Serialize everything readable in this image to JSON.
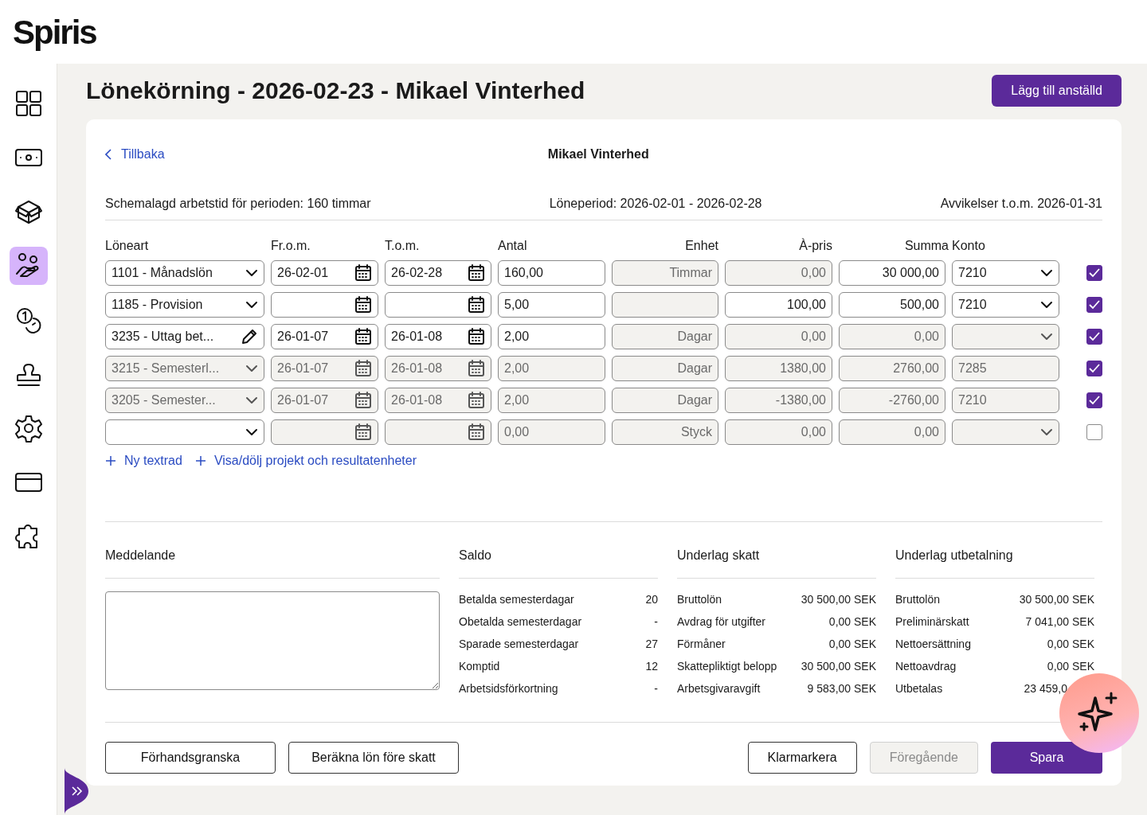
{
  "logo": "Spiris",
  "sidebar": {
    "items": [
      {
        "selected": false
      },
      {
        "selected": false
      },
      {
        "selected": false
      },
      {
        "selected": true
      },
      {
        "selected": false
      },
      {
        "selected": false
      },
      {
        "selected": false
      },
      {
        "selected": false
      },
      {
        "selected": false
      }
    ]
  },
  "page_title": "Lönekörning - 2026-02-23 - Mikael Vinterhed",
  "add_employee_button": "Lägg till anställd",
  "back_link": "Tillbaka",
  "employee_name": "Mikael Vinterhed",
  "info": [
    "Schemalagd arbetstid för perioden: 160 timmar",
    "Löneperiod: 2026-02-01 - 2026-02-28",
    "Avvikelser t.o.m. 2026-01-31"
  ],
  "table": {
    "columns": [
      "Löneart",
      "Fr.o.m.",
      "T.o.m.",
      "Antal",
      "Enhet",
      "À-pris",
      "Summa",
      "Konto"
    ],
    "rows": [
      {
        "art": {
          "value": "1101 - Månadslön",
          "kind": "select",
          "disabled": false
        },
        "from": {
          "value": "26-02-01",
          "disabled": false
        },
        "to": {
          "value": "26-02-28",
          "disabled": false
        },
        "antal": {
          "value": "160,00",
          "disabled": false
        },
        "enhet": {
          "value": "Timmar",
          "disabled": true
        },
        "apris": {
          "value": "0,00",
          "disabled": true
        },
        "summa": {
          "value": "30 000,00",
          "disabled": false
        },
        "konto": {
          "value": "7210",
          "kind": "select",
          "disabled": false
        },
        "checked": true
      },
      {
        "art": {
          "value": "1185 - Provision",
          "kind": "select",
          "disabled": false
        },
        "from": {
          "disabled": false
        },
        "to": {
          "disabled": false
        },
        "antal": {
          "value": "5,00",
          "disabled": false
        },
        "enhet": {
          "disabled": true
        },
        "apris": {
          "value": "100,00",
          "disabled": false
        },
        "summa": {
          "value": "500,00",
          "disabled": false
        },
        "konto": {
          "value": "7210",
          "kind": "select",
          "disabled": false
        },
        "checked": true
      },
      {
        "art": {
          "value": "3235 - Uttag bet...",
          "kind": "edit",
          "disabled": false
        },
        "from": {
          "value": "26-01-07",
          "disabled": false
        },
        "to": {
          "value": "26-01-08",
          "disabled": false
        },
        "antal": {
          "value": "2,00",
          "disabled": false
        },
        "enhet": {
          "value": "Dagar",
          "disabled": true
        },
        "apris": {
          "value": "0,00",
          "disabled": true
        },
        "summa": {
          "value": "0,00",
          "disabled": true
        },
        "konto": {
          "kind": "select",
          "disabled": true
        },
        "checked": true
      },
      {
        "art": {
          "value": "3215 - Semesterl...",
          "kind": "select",
          "disabled": true
        },
        "from": {
          "value": "26-01-07",
          "disabled": true
        },
        "to": {
          "value": "26-01-08",
          "disabled": true
        },
        "antal": {
          "value": "2,00",
          "disabled": true
        },
        "enhet": {
          "value": "Dagar",
          "disabled": true
        },
        "apris": {
          "value": "1380,00",
          "disabled": true
        },
        "summa": {
          "value": "2760,00",
          "disabled": true
        },
        "konto": {
          "value": "7285",
          "kind": "text",
          "disabled": true
        },
        "checked": true
      },
      {
        "art": {
          "value": "3205 - Semester...",
          "kind": "select",
          "disabled": true
        },
        "from": {
          "value": "26-01-07",
          "disabled": true
        },
        "to": {
          "value": "26-01-08",
          "disabled": true
        },
        "antal": {
          "value": "2,00",
          "disabled": true
        },
        "enhet": {
          "value": "Dagar",
          "disabled": true
        },
        "apris": {
          "value": "-1380,00",
          "disabled": true
        },
        "summa": {
          "value": "-2760,00",
          "disabled": true
        },
        "konto": {
          "value": "7210",
          "kind": "text",
          "disabled": true
        },
        "checked": true
      },
      {
        "art": {
          "kind": "select",
          "disabled": false
        },
        "from": {
          "disabled": true
        },
        "to": {
          "disabled": true
        },
        "antal": {
          "value": "0,00",
          "disabled": true
        },
        "enhet": {
          "value": "Styck",
          "disabled": true
        },
        "apris": {
          "value": "0,00",
          "disabled": true
        },
        "summa": {
          "value": "0,00",
          "disabled": true
        },
        "konto": {
          "kind": "select",
          "disabled": true
        },
        "checked": false
      }
    ]
  },
  "links": [
    "Ny textrad",
    "Visa/dölj projekt och resultatenheter"
  ],
  "message": {
    "title": "Meddelande"
  },
  "summaries": [
    {
      "title": "Saldo",
      "rows": [
        {
          "label": "Betalda semesterdagar",
          "value": "20"
        },
        {
          "label": "Obetalda semesterdagar",
          "value": "-"
        },
        {
          "label": "Sparade semesterdagar",
          "value": "27"
        },
        {
          "label": "Komptid",
          "value": "12"
        },
        {
          "label": "Arbetsidsförkortning",
          "value": "-"
        }
      ]
    },
    {
      "title": "Underlag skatt",
      "rows": [
        {
          "label": "Bruttolön",
          "value": "30 500,00 SEK"
        },
        {
          "label": "Avdrag för utgifter",
          "value": "0,00 SEK"
        },
        {
          "label": "Förmåner",
          "value": "0,00 SEK"
        },
        {
          "label": "Skattepliktigt belopp",
          "value": "30 500,00 SEK"
        },
        {
          "label": "Arbetsgivaravgift",
          "value": "9 583,00 SEK"
        }
      ]
    },
    {
      "title": "Underlag utbetalning",
      "rows": [
        {
          "label": "Bruttolön",
          "value": "30 500,00 SEK"
        },
        {
          "label": "Preliminärskatt",
          "value": "7 041,00 SEK"
        },
        {
          "label": "Nettoersättning",
          "value": "0,00 SEK"
        },
        {
          "label": "Nettoavdrag",
          "value": "0,00 SEK"
        },
        {
          "label": "Utbetalas",
          "value": "23 459,0"
        }
      ]
    }
  ],
  "buttons": [
    {
      "label": "Förhandsgranska",
      "kind": "outline",
      "disabled": false
    },
    {
      "label": "Beräkna lön före skatt",
      "kind": "outline",
      "disabled": false
    },
    {
      "label": "Klarmarkera",
      "kind": "outline",
      "disabled": false
    },
    {
      "label": "Föregående",
      "kind": "outline",
      "disabled": true
    },
    {
      "label": "Spara",
      "kind": "primary",
      "disabled": false
    }
  ]
}
